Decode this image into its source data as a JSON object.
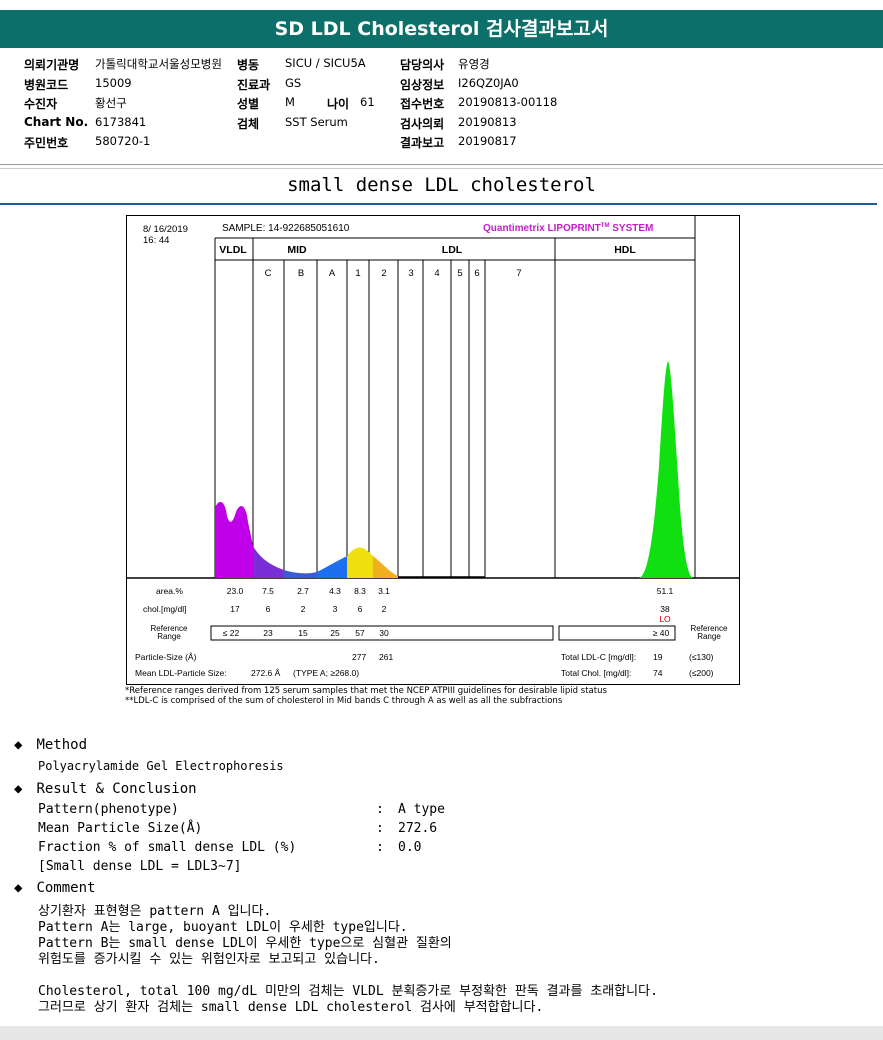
{
  "title": "SD LDL Cholesterol 검사결과보고서",
  "header": {
    "col1": [
      {
        "label": "의뢰기관명",
        "value": "가톨릭대학교서울성모병원"
      },
      {
        "label": "병원코드",
        "value": "15009"
      },
      {
        "label": "수진자",
        "value": "황선구"
      },
      {
        "label": "Chart No.",
        "value": "6173841"
      },
      {
        "label": "주민번호",
        "value": "580720-1"
      }
    ],
    "col2": [
      {
        "label": "병동",
        "value": "SICU / SICU5A"
      },
      {
        "label": "진료과",
        "value": "GS"
      },
      {
        "label": "성별",
        "value": "M"
      },
      {
        "label": "검체",
        "value": "SST Serum"
      }
    ],
    "age": {
      "label": "나이",
      "value": "61"
    },
    "col3": [
      {
        "label": "담당의사",
        "value": "유영경"
      },
      {
        "label": "임상정보",
        "value": "I26QZ0JA0"
      },
      {
        "label": "접수번호",
        "value": "20190813-00118"
      },
      {
        "label": "검사의뢰",
        "value": "20190813"
      },
      {
        "label": "결과보고",
        "value": "20190817"
      }
    ]
  },
  "subtitle": "small dense LDL cholesterol",
  "chart_data": {
    "type": "area",
    "date": "8/ 16/2019",
    "time": "16: 44",
    "sample": "SAMPLE:  14-922685051610",
    "brand": "Quantimetrix LIPOPRINT",
    "brand_tm": "TM",
    "brand_suffix": " SYSTEM",
    "group_labels": {
      "vldl": "VLDL",
      "mid": "MID",
      "ldl": "LDL",
      "hdl": "HDL"
    },
    "band_labels": [
      "C",
      "B",
      "A",
      "1",
      "2",
      "3",
      "4",
      "5",
      "6",
      "7"
    ],
    "band_colors": {
      "vldl": "#c000e8",
      "c": "#7a2ed8",
      "b": "#3b5ad8",
      "a": "#1e6ef0",
      "ldl1": "#f0e010",
      "ldl2": "#f0b020",
      "hdl": "#10e010"
    },
    "row_labels": {
      "area": "area.%",
      "chol": "chol.[mg/dl]",
      "ref": "Reference\nRange",
      "ref_right": "Reference\nRange"
    },
    "area": [
      "23.0",
      "7.5",
      "2.7",
      "4.3",
      "8.3",
      "3.1",
      "51.1"
    ],
    "chol": [
      "17",
      "6",
      "2",
      "3",
      "6",
      "2",
      "38"
    ],
    "chol_flag": "LO",
    "reference": [
      "≤ 22",
      "23",
      "15",
      "25",
      "57",
      "30",
      "≥ 40"
    ],
    "particle_size_label": "Particle-Size (Å)",
    "particle_size": [
      "277",
      "261"
    ],
    "mean_ldl_label": "Mean LDL-Particle Size:",
    "mean_ldl_value": "272.6 Å",
    "mean_ldl_type": "(TYPE A; ≥268.0)",
    "total_ldl_label": "Total LDL-C [mg/dl]:",
    "total_ldl_value": "19",
    "total_ldl_ref": "(≤130)",
    "total_chol_label": "Total Chol. [mg/dl]:",
    "total_chol_value": "74",
    "total_chol_ref": "(≤200)"
  },
  "footnotes": [
    "*Reference ranges derived from 125 serum samples that met the NCEP ATPIII guidelines for desirable lipid status",
    "**LDL-C is comprised of the sum of cholesterol in Mid bands C through A as well as all the subfractions"
  ],
  "method": {
    "heading": "Method",
    "text": "Polyacrylamide Gel Electrophoresis"
  },
  "result": {
    "heading": "Result & Conclusion",
    "rows": [
      {
        "label": "Pattern(phenotype)",
        "value": "A type"
      },
      {
        "label": "Mean Particle Size(Å)",
        "value": "272.6"
      },
      {
        "label": "Fraction % of small dense LDL (%)",
        "value": "0.0"
      }
    ],
    "note": "[Small dense LDL = LDL3~7]"
  },
  "comment": {
    "heading": "Comment",
    "lines": [
      "상기환자 표현형은 pattern A 입니다.",
      "Pattern A는 large, buoyant LDL이 우세한 type입니다.",
      "Pattern B는 small dense LDL이 우세한 type으로 심혈관 질환의",
      "위험도를 증가시킬 수 있는 위험인자로 보고되고 있습니다.",
      "",
      "Cholesterol, total 100 mg/dL 미만의 검체는 VLDL 분획증가로 부정확한 판독 결과를 초래합니다.",
      "그러므로 상기 환자 검체는 small dense LDL cholesterol 검사에 부적합합니다."
    ]
  }
}
